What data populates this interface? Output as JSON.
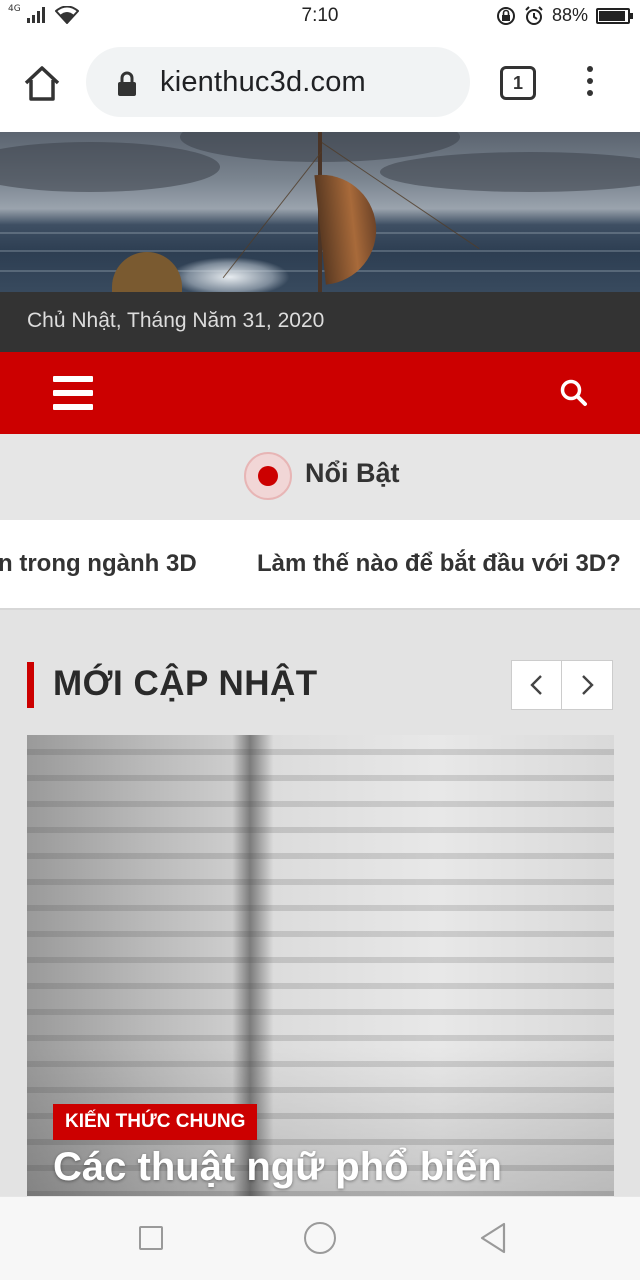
{
  "status_bar": {
    "network": "4G",
    "time": "7:10",
    "battery_percent": "88%",
    "battery_level": 0.88
  },
  "browser": {
    "url": "kienthuc3d.com",
    "tab_count": "1",
    "icons": [
      "home-icon",
      "lock-icon",
      "tabs-icon",
      "more-vert-icon"
    ]
  },
  "site": {
    "date": "Chủ Nhật, Tháng Năm 31, 2020",
    "featured_label": "Nổi Bật",
    "ticker": [
      "n trong ngành 3D",
      "Làm thế nào để bắt đầu với 3D?"
    ],
    "latest_title": "MỚI CẬP NHẬT",
    "article": {
      "category": "KIẾN THỨC CHUNG",
      "title": "Các thuật ngữ phổ biến"
    }
  },
  "colors": {
    "accent_red": "#cc0000",
    "date_bar": "#333333",
    "featured_bg": "#e6e6e6"
  }
}
